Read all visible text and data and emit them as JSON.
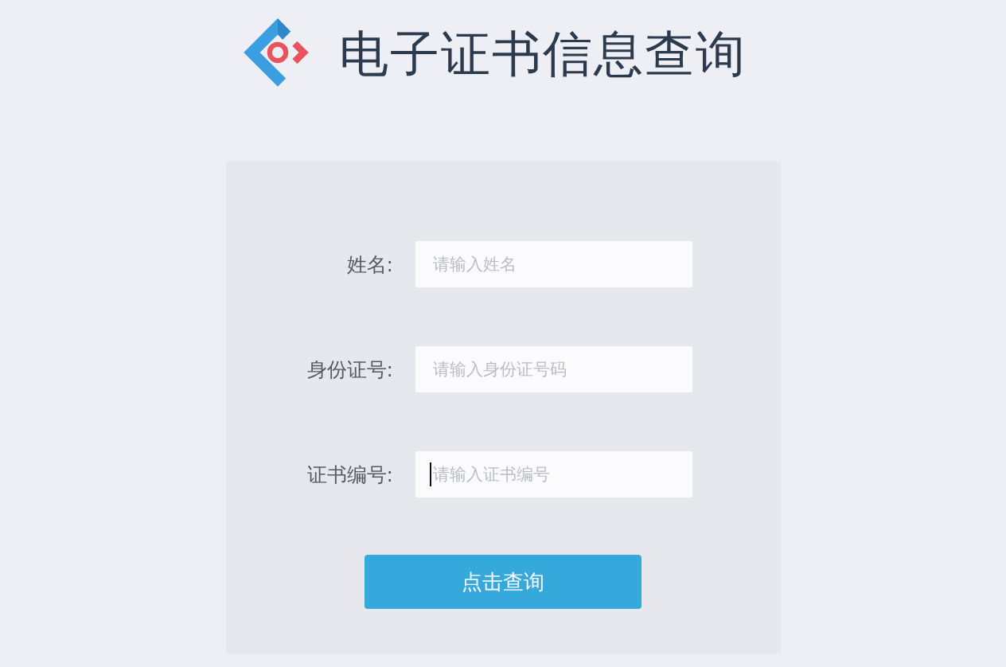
{
  "header": {
    "title": "电子证书信息查询"
  },
  "form": {
    "fields": [
      {
        "label": "姓名:",
        "placeholder": "请输入姓名",
        "focused": false
      },
      {
        "label": "身份证号:",
        "placeholder": "请输入身份证号码",
        "focused": false
      },
      {
        "label": "证书编号:",
        "placeholder": "请输入证书编号",
        "focused": true
      }
    ],
    "submit": "点击查询"
  }
}
